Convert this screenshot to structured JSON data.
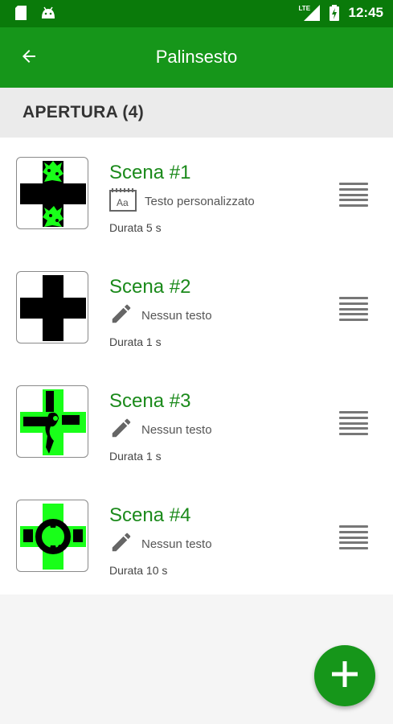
{
  "status_bar": {
    "time": "12:45",
    "network": "LTE",
    "icons": [
      "sd-card-icon",
      "android-icon",
      "signal-icon",
      "battery-charging-icon"
    ]
  },
  "app_bar": {
    "title": "Palinsesto",
    "back_icon": "arrow-back-icon"
  },
  "section": {
    "title": "APERTURA (4)"
  },
  "scenes": [
    {
      "title": "Scena #1",
      "text_icon": "text-style-icon",
      "text_label": "Testo personalizzato",
      "duration": "Durata 5 s",
      "thumbnail": "black cross with green accents top and bottom"
    },
    {
      "title": "Scena #2",
      "text_icon": "pencil-icon",
      "text_label": "Nessun testo",
      "duration": "Durata 1 s",
      "thumbnail": "black cross"
    },
    {
      "title": "Scena #3",
      "text_icon": "pencil-icon",
      "text_label": "Nessun testo",
      "duration": "Durata 1 s",
      "thumbnail": "green cross with black figure"
    },
    {
      "title": "Scena #4",
      "text_icon": "pencil-icon",
      "text_label": "Nessun testo",
      "duration": "Durata 10 s",
      "thumbnail": "green cross with black circle"
    }
  ],
  "fab": {
    "icon": "plus-icon"
  },
  "colors": {
    "status_bar": "#0a7a0a",
    "app_bar": "#16961a",
    "accent_green": "#1b8a1b",
    "cross_green": "#19ff19",
    "section_bg": "#ebebeb"
  }
}
